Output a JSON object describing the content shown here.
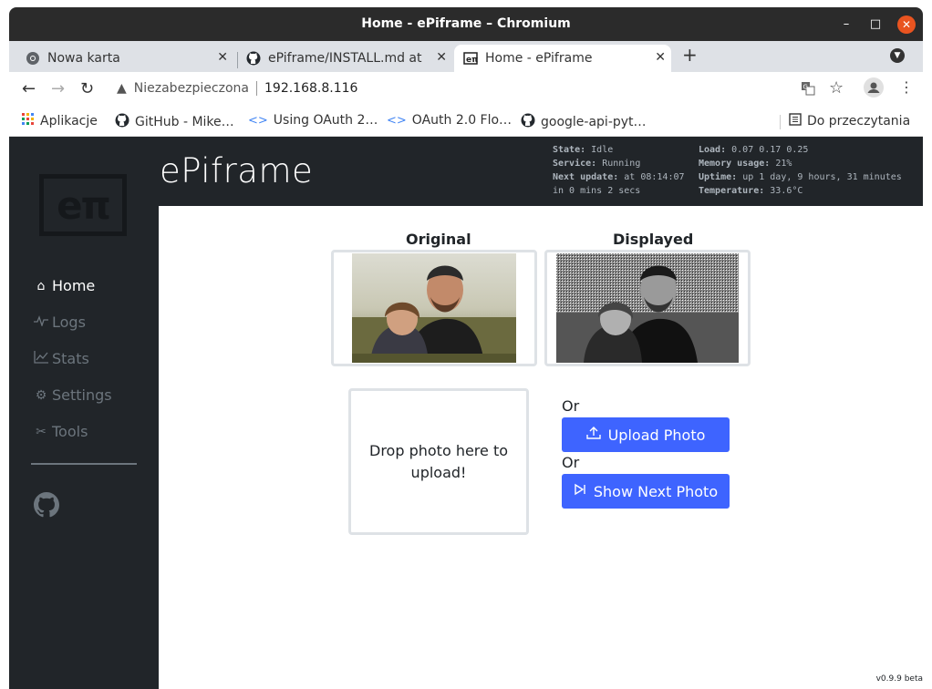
{
  "window": {
    "title": "Home - ePiframe – Chromium"
  },
  "tabs": [
    {
      "label": "Nowa karta",
      "icon": "chrome-icon"
    },
    {
      "label": "ePiframe/INSTALL.md at",
      "icon": "github-icon"
    },
    {
      "label": "Home - ePiframe",
      "icon": "epiframe-favicon"
    }
  ],
  "omnibox": {
    "security": "Niezabezpieczona",
    "url": "192.168.8.116"
  },
  "bookmarks": [
    {
      "label": "Aplikacje"
    },
    {
      "label": "GitHub - Mike…"
    },
    {
      "label": "Using OAuth 2…"
    },
    {
      "label": "OAuth 2.0 Flo…"
    },
    {
      "label": "google-api-pyt…"
    }
  ],
  "reading_list": "Do przeczytania",
  "app": {
    "brand": "ePiframe",
    "logo": "eπ",
    "nav": [
      {
        "label": "Home",
        "icon": "home-icon",
        "active": true
      },
      {
        "label": "Logs",
        "icon": "pulse-icon",
        "active": false
      },
      {
        "label": "Stats",
        "icon": "chart-icon",
        "active": false
      },
      {
        "label": "Settings",
        "icon": "gear-icon",
        "active": false
      },
      {
        "label": "Tools",
        "icon": "tools-icon",
        "active": false
      }
    ],
    "status": {
      "state_label": "State:",
      "state": "Idle",
      "service_label": "Service:",
      "service": "Running",
      "next_update_label": "Next update:",
      "next_update": "at 08:14:07",
      "next_update_in": "in 0 mins 2 secs",
      "load_label": "Load:",
      "load": "0.07 0.17 0.25",
      "memory_label": "Memory usage:",
      "memory": "21%",
      "uptime_label": "Uptime:",
      "uptime": "up 1 day, 9 hours, 31 minutes",
      "temperature_label": "Temperature:",
      "temperature": "33.6°C"
    },
    "original_label": "Original",
    "displayed_label": "Displayed",
    "dropzone": "Drop photo here to upload!",
    "or1": "Or",
    "or2": "Or",
    "upload_button": "Upload Photo",
    "next_button": "Show Next Photo",
    "version": "v0.9.9 beta"
  }
}
